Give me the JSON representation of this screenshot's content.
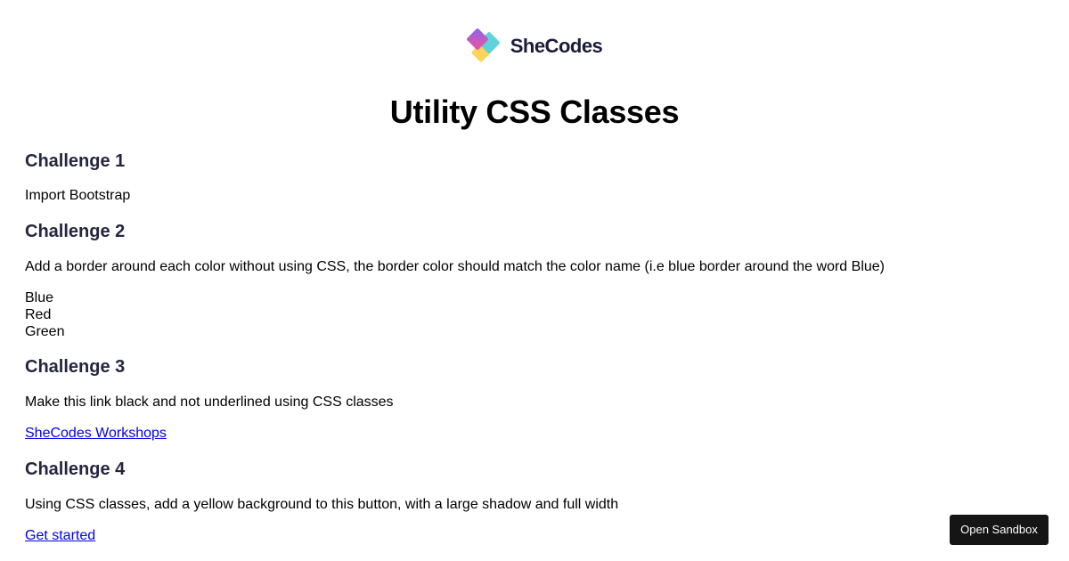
{
  "header": {
    "logo_text": "SheCodes",
    "title": "Utility CSS Classes"
  },
  "challenges": [
    {
      "heading": "Challenge 1",
      "description": "Import Bootstrap"
    },
    {
      "heading": "Challenge 2",
      "description": "Add a border around each color without using CSS, the border color should match the color name (i.e blue border around the word Blue)",
      "colors": [
        "Blue",
        "Red",
        "Green"
      ]
    },
    {
      "heading": "Challenge 3",
      "description": "Make this link black and not underlined using CSS classes",
      "link_text": "SheCodes Workshops"
    },
    {
      "heading": "Challenge 4",
      "description": "Using CSS classes, add a yellow background to this button, with a large shadow and full width",
      "link_text": "Get started"
    }
  ],
  "sandbox_button": {
    "label": "Open Sandbox"
  },
  "colors": {
    "link": "#0000ee",
    "heading": "#252540",
    "logo_text": "#1c1b3a",
    "button_bg": "#151515",
    "logo_pink": "#f2559a",
    "logo_purple": "#8a63f0",
    "logo_teal": "#5fd3d8",
    "logo_yellow": "#fdd35a"
  }
}
